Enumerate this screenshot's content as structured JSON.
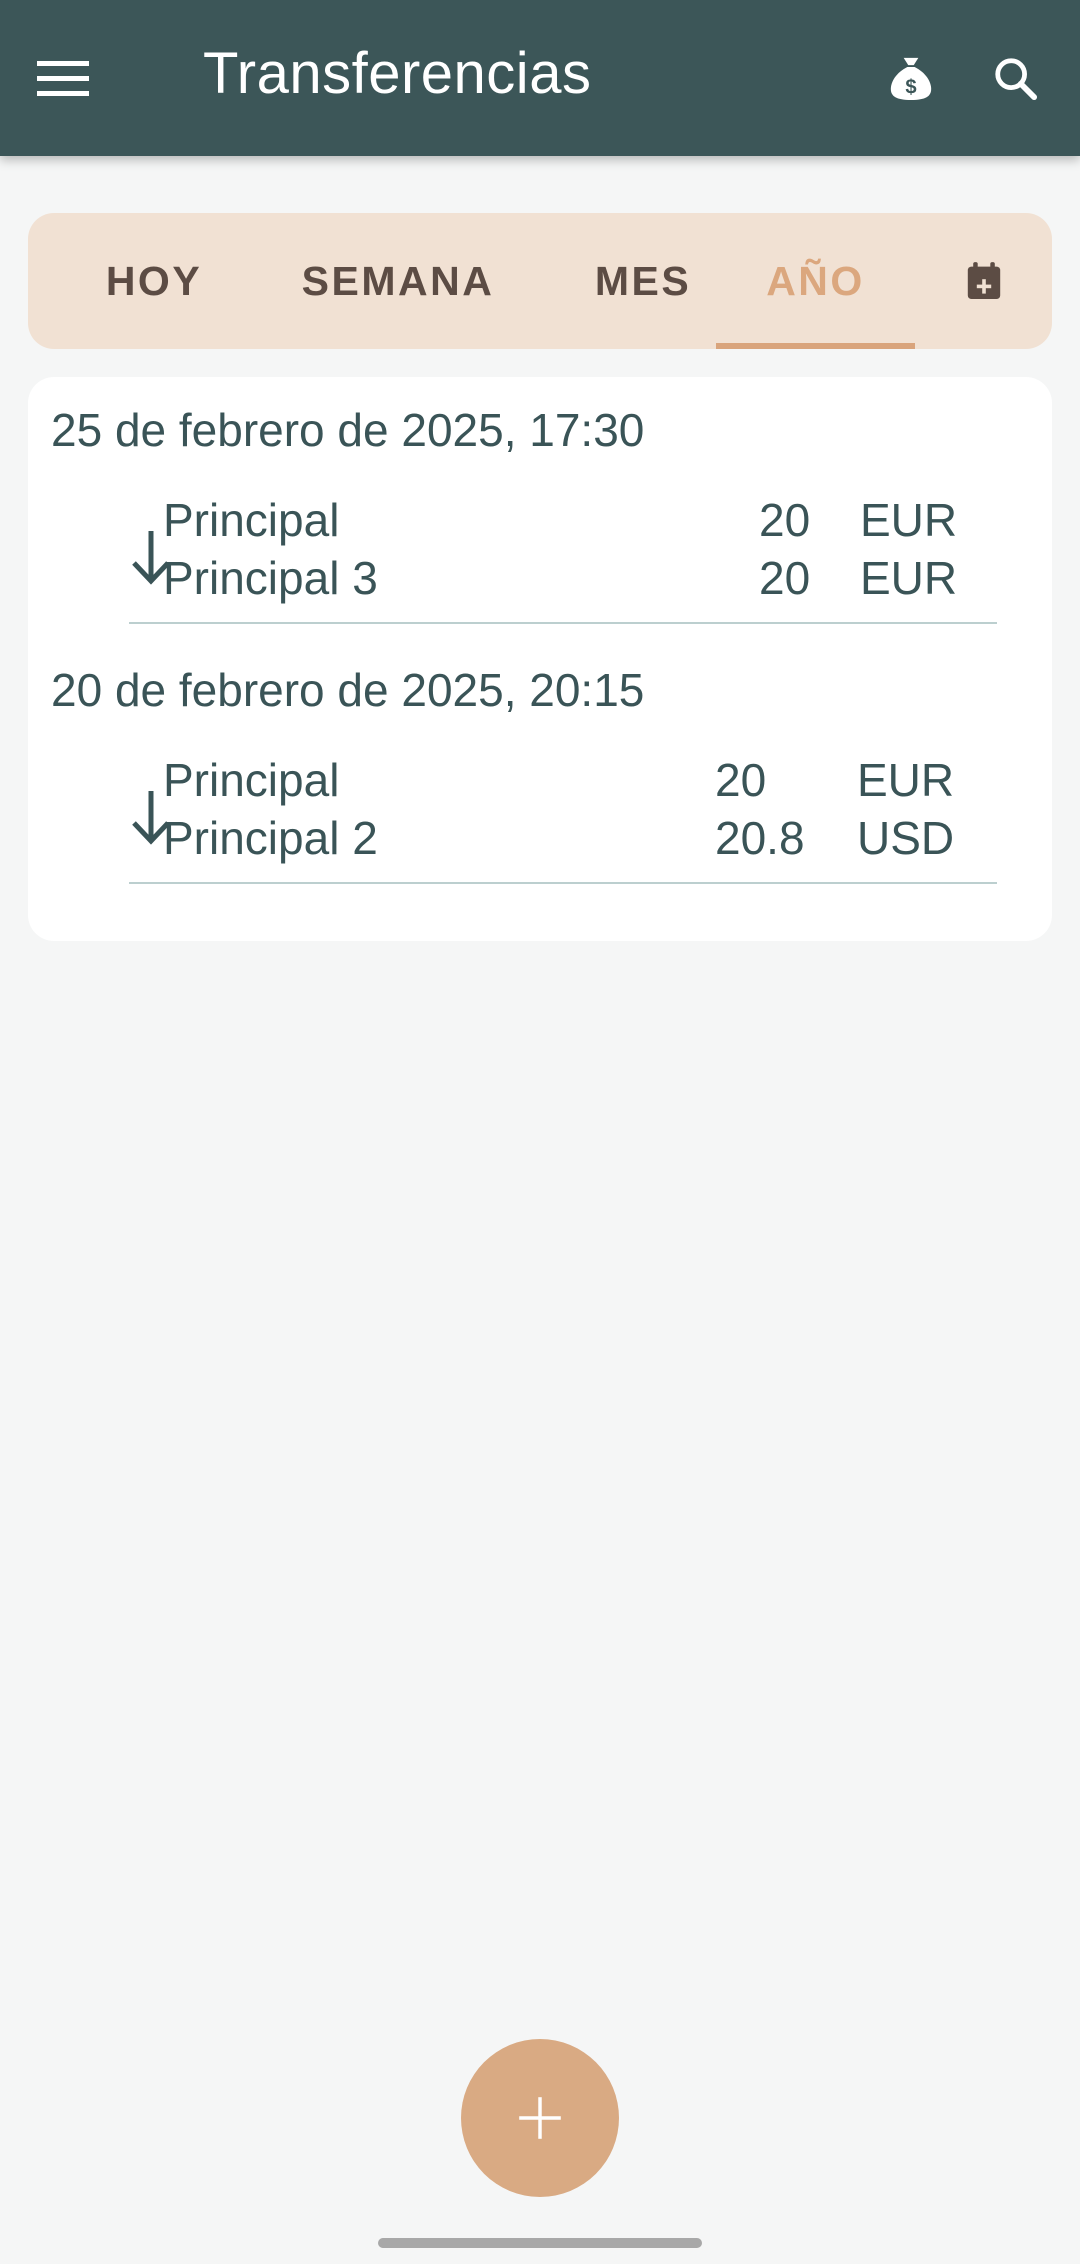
{
  "appbar": {
    "title": "Transferencias",
    "menu_icon": "hamburger-menu-icon",
    "money_icon": "money-bag-icon",
    "search_icon": "search-icon",
    "background": "#3c5658"
  },
  "tabs": {
    "items": [
      {
        "label": "HOY"
      },
      {
        "label": "SEMANA"
      },
      {
        "label": "MES"
      },
      {
        "label": "AÑO",
        "active": true
      }
    ],
    "calendar_icon": "calendar-add-icon",
    "accent": "#d9a47c"
  },
  "transfers": [
    {
      "date": "25 de febrero de 2025, 17:30",
      "from": {
        "account": "Principal",
        "amount": "20",
        "currency": "EUR"
      },
      "to": {
        "account": "Principal 3",
        "amount": "20",
        "currency": "EUR"
      }
    },
    {
      "date": "20 de febrero de 2025, 20:15",
      "from": {
        "account": "Principal",
        "amount": "20",
        "currency": "EUR"
      },
      "to": {
        "account": "Principal 2",
        "amount": "20.8",
        "currency": "USD"
      }
    }
  ],
  "fab": {
    "icon": "plus-icon",
    "color": "#d9aa83"
  }
}
